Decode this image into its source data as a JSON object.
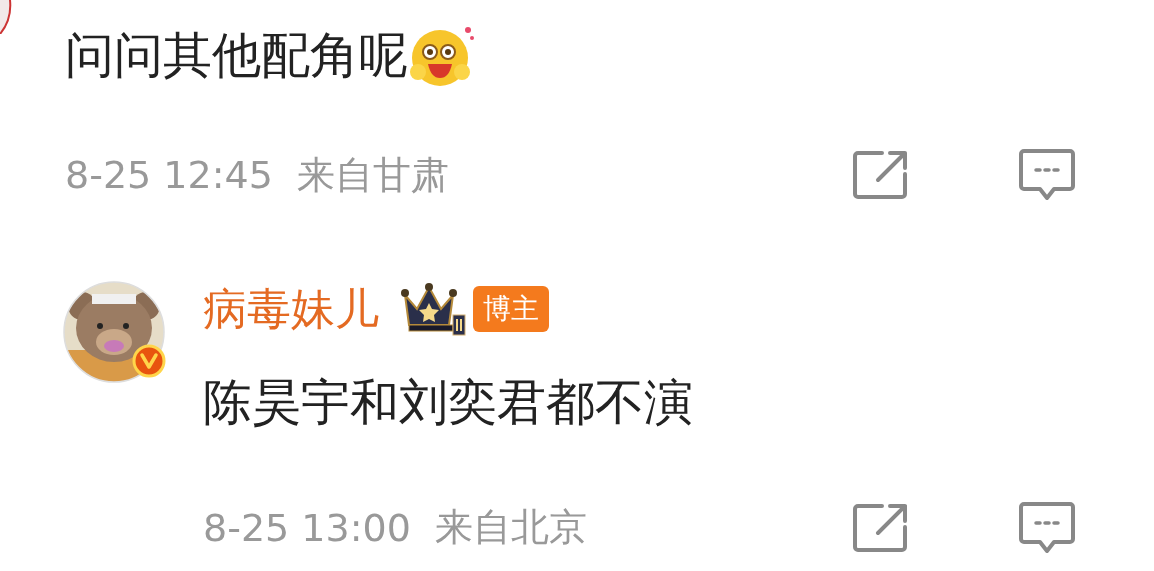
{
  "comments": [
    {
      "kind": "comment",
      "text": "问问其他配角呢",
      "date": "8-25 12:45",
      "location": "来自甘肃"
    },
    {
      "kind": "reply",
      "author": "病毒妹儿",
      "verified": true,
      "badge": "博主",
      "text": "陈昊宇和刘奕君都不演",
      "date": "8-25 13:00",
      "location": "来自北京"
    }
  ]
}
